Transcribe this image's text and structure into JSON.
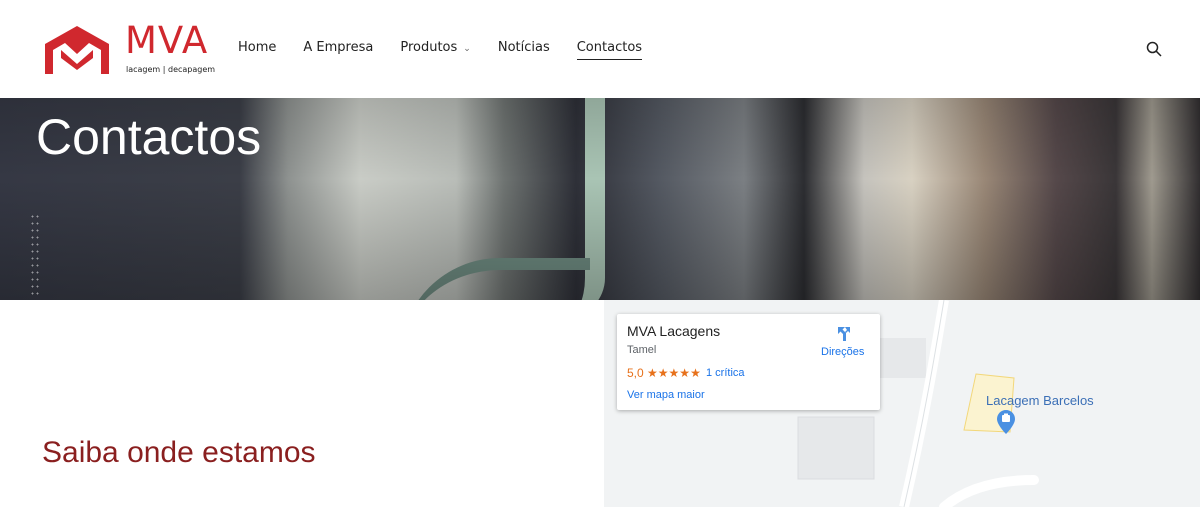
{
  "header": {
    "logo_text": "MVA",
    "logo_sub": "lacagem | decapagem",
    "nav": [
      {
        "label": "Home"
      },
      {
        "label": "A Empresa"
      },
      {
        "label": "Produtos",
        "has_dropdown": true
      },
      {
        "label": "Notícias"
      },
      {
        "label": "Contactos",
        "active": true
      }
    ],
    "search_icon": "search-icon"
  },
  "hero": {
    "title": "Contactos"
  },
  "section": {
    "title": "Saiba onde estamos"
  },
  "map": {
    "card": {
      "title": "MVA Lacagens",
      "location": "Tamel",
      "rating": "5,0",
      "stars": "★★★★★",
      "reviews": "1 crítica",
      "bigger_map": "Ver mapa maior",
      "directions": "Direções"
    },
    "place_label": "Lacagem Barcelos"
  },
  "colors": {
    "brand_red": "#d0282e",
    "section_title": "#8a1f1f",
    "link_blue": "#1a73e8",
    "rating_orange": "#e7711b"
  }
}
